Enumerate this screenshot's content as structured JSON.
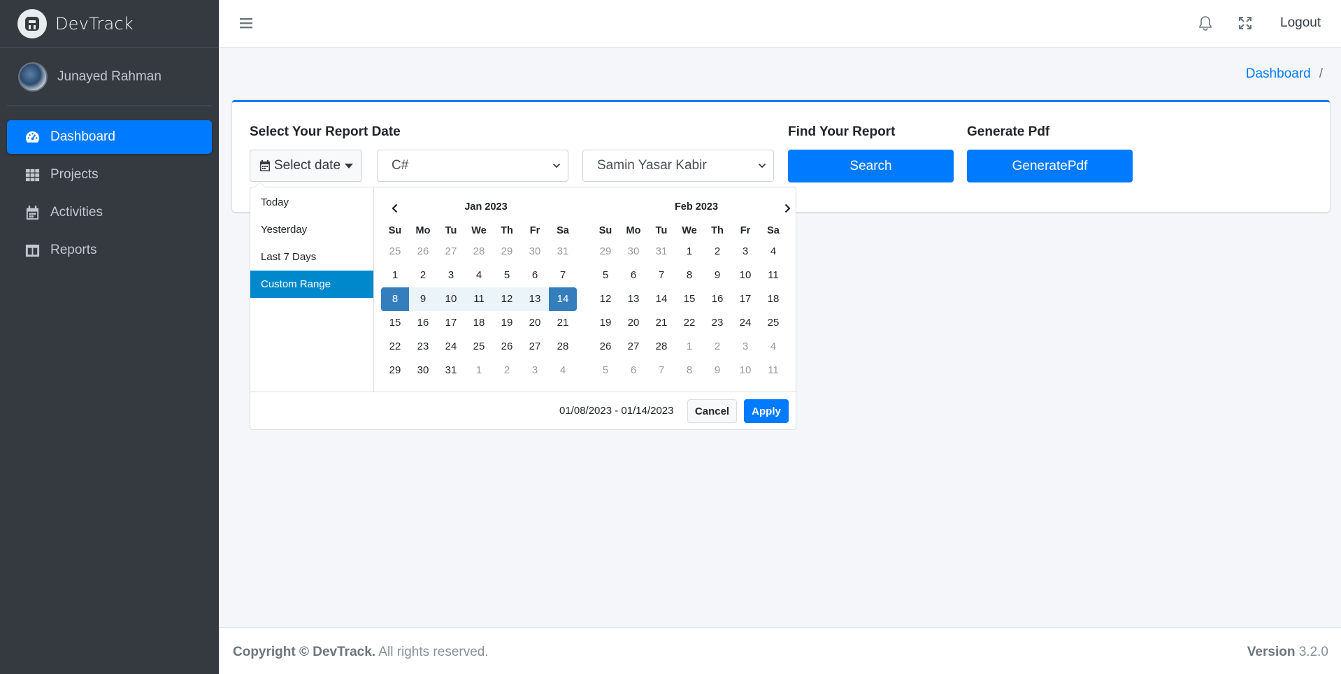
{
  "brand": {
    "name": "DevTrack",
    "logo_icon": "devtrack-logo-icon"
  },
  "user": {
    "name": "Junayed Rahman"
  },
  "sidebar": {
    "items": [
      {
        "label": "Dashboard",
        "icon": "tachometer-icon",
        "active": true
      },
      {
        "label": "Projects",
        "icon": "grid-icon",
        "active": false
      },
      {
        "label": "Activities",
        "icon": "calendar-icon",
        "active": false
      },
      {
        "label": "Reports",
        "icon": "columns-icon",
        "active": false
      }
    ]
  },
  "topbar": {
    "logout_label": "Logout"
  },
  "breadcrumb": {
    "current": "Dashboard",
    "separator": "/"
  },
  "report": {
    "date_label": "Select Your Report Date",
    "select_date_button": "Select date",
    "language_select": "C#",
    "person_select": "Samin Yasar Kabir",
    "find_label": "Find Your Report",
    "search_button": "Search",
    "pdf_label": "Generate Pdf",
    "pdf_button": "GeneratePdf"
  },
  "datepicker": {
    "ranges": [
      "Today",
      "Yesterday",
      "Last 7 Days",
      "Custom Range"
    ],
    "active_range": "Custom Range",
    "days_of_week": [
      "Su",
      "Mo",
      "Tu",
      "We",
      "Th",
      "Fr",
      "Sa"
    ],
    "left_month": "Jan 2023",
    "right_month": "Feb 2023",
    "left_weeks": [
      [
        "25",
        "26",
        "27",
        "28",
        "29",
        "30",
        "31"
      ],
      [
        "1",
        "2",
        "3",
        "4",
        "5",
        "6",
        "7"
      ],
      [
        "8",
        "9",
        "10",
        "11",
        "12",
        "13",
        "14"
      ],
      [
        "15",
        "16",
        "17",
        "18",
        "19",
        "20",
        "21"
      ],
      [
        "22",
        "23",
        "24",
        "25",
        "26",
        "27",
        "28"
      ],
      [
        "29",
        "30",
        "31",
        "1",
        "2",
        "3",
        "4"
      ]
    ],
    "right_weeks": [
      [
        "29",
        "30",
        "31",
        "1",
        "2",
        "3",
        "4"
      ],
      [
        "5",
        "6",
        "7",
        "8",
        "9",
        "10",
        "11"
      ],
      [
        "12",
        "13",
        "14",
        "15",
        "16",
        "17",
        "18"
      ],
      [
        "19",
        "20",
        "21",
        "22",
        "23",
        "24",
        "25"
      ],
      [
        "26",
        "27",
        "28",
        "1",
        "2",
        "3",
        "4"
      ],
      [
        "5",
        "6",
        "7",
        "8",
        "9",
        "10",
        "11"
      ]
    ],
    "selected_range_text": "01/08/2023 - 01/14/2023",
    "cancel_label": "Cancel",
    "apply_label": "Apply"
  },
  "footer": {
    "copyright_prefix": "Copyright © DevTrack.",
    "copyright_suffix": "All rights reserved.",
    "version_label": "Version",
    "version_value": "3.2.0"
  },
  "colors": {
    "primary": "#007bff",
    "sidebar_bg": "#343a40",
    "range_selected": "#357ebd",
    "range_in": "#ebf4f8",
    "range_active": "#0088cc"
  }
}
